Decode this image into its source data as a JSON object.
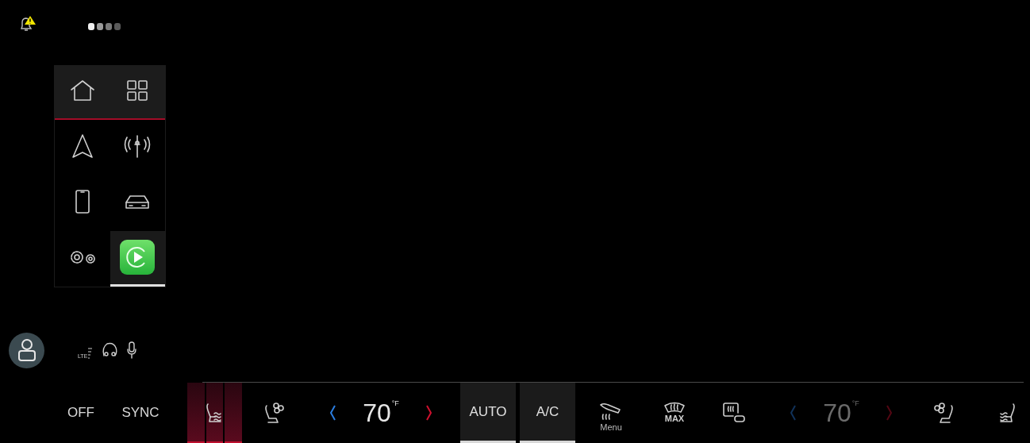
{
  "notification": {
    "alert": true
  },
  "page_dots": [
    {
      "selected": true
    },
    {
      "selected": false
    },
    {
      "selected": false
    },
    {
      "selected": false
    }
  ],
  "launcher": {
    "pinned": [
      {
        "kind": "home",
        "selected": false
      },
      {
        "kind": "apps",
        "selected": false
      }
    ],
    "apps": [
      {
        "kind": "navigation",
        "selected": false
      },
      {
        "kind": "radio",
        "selected": false
      },
      {
        "kind": "phone",
        "selected": false
      },
      {
        "kind": "vehicle",
        "selected": false
      },
      {
        "kind": "settings",
        "selected": false
      },
      {
        "kind": "carplay",
        "selected": true
      }
    ]
  },
  "status": {
    "network": "LTE",
    "icons": [
      {
        "kind": "voice"
      },
      {
        "kind": "microphone"
      }
    ]
  },
  "climate_bar": [
    {
      "kind": "text",
      "label": "OFF"
    },
    {
      "kind": "text",
      "label": "SYNC"
    },
    {
      "kind": "heated-seat",
      "on": true
    },
    {
      "kind": "vented-seat"
    },
    {
      "kind": "temperature",
      "value": "70",
      "unit": "°F",
      "disabled": false
    },
    {
      "kind": "mode",
      "label": "AUTO",
      "on": true
    },
    {
      "kind": "mode",
      "label": "A/C",
      "on": true
    },
    {
      "kind": "airflow",
      "label": "Menu"
    },
    {
      "kind": "defrost",
      "label": "MAX"
    },
    {
      "kind": "rear-defrost"
    },
    {
      "kind": "temperature",
      "value": "70",
      "unit": "°F",
      "disabled": true
    },
    {
      "kind": "vented-seat"
    },
    {
      "kind": "heated-seat",
      "on": false
    }
  ]
}
